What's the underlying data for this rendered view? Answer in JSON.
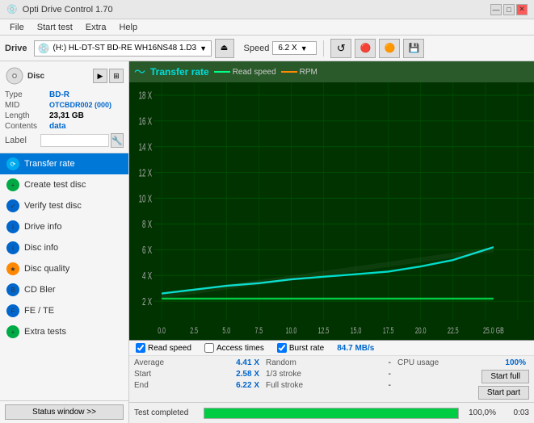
{
  "app": {
    "title": "Opti Drive Control 1.70",
    "title_icon": "💿"
  },
  "title_controls": {
    "minimize": "—",
    "maximize": "□",
    "close": "✕"
  },
  "menu": {
    "items": [
      "File",
      "Start test",
      "Extra",
      "Help"
    ]
  },
  "toolbar": {
    "drive_label": "Drive",
    "drive_value": "(H:) HL-DT-ST BD-RE  WH16NS48 1.D3",
    "speed_label": "Speed",
    "speed_value": "6.2 X"
  },
  "disc": {
    "type_label": "Type",
    "type_value": "BD-R",
    "mid_label": "MID",
    "mid_value": "OTCBDR002 (000)",
    "length_label": "Length",
    "length_value": "23,31 GB",
    "contents_label": "Contents",
    "contents_value": "data",
    "label_label": "Label",
    "label_value": ""
  },
  "nav": {
    "items": [
      {
        "id": "transfer-rate",
        "label": "Transfer rate",
        "active": true
      },
      {
        "id": "create-test-disc",
        "label": "Create test disc",
        "active": false
      },
      {
        "id": "verify-test-disc",
        "label": "Verify test disc",
        "active": false
      },
      {
        "id": "drive-info",
        "label": "Drive info",
        "active": false
      },
      {
        "id": "disc-info",
        "label": "Disc info",
        "active": false
      },
      {
        "id": "disc-quality",
        "label": "Disc quality",
        "active": false
      },
      {
        "id": "cd-bler",
        "label": "CD Bler",
        "active": false
      },
      {
        "id": "fe-te",
        "label": "FE / TE",
        "active": false
      },
      {
        "id": "extra-tests",
        "label": "Extra tests",
        "active": false
      }
    ]
  },
  "status_btn": "Status window >>",
  "chart": {
    "title": "Transfer rate",
    "legend": {
      "read_speed_label": "Read speed",
      "rpm_label": "RPM"
    },
    "y_labels": [
      "18 X",
      "16 X",
      "14 X",
      "12 X",
      "10 X",
      "8 X",
      "6 X",
      "4 X",
      "2 X"
    ],
    "x_labels": [
      "0.0",
      "2.5",
      "5.0",
      "7.5",
      "10.0",
      "12.5",
      "15.0",
      "17.5",
      "20.0",
      "22.5",
      "25.0 GB"
    ],
    "checkboxes": [
      {
        "id": "read-speed",
        "label": "Read speed",
        "checked": true
      },
      {
        "id": "access-times",
        "label": "Access times",
        "checked": false
      },
      {
        "id": "burst-rate",
        "label": "Burst rate",
        "checked": true
      }
    ],
    "burst_value": "84.7 MB/s"
  },
  "stats": {
    "average_label": "Average",
    "average_value": "4.41 X",
    "start_label": "Start",
    "start_value": "2.58 X",
    "end_label": "End",
    "end_value": "6.22 X",
    "random_label": "Random",
    "random_value": "-",
    "one_third_label": "1/3 stroke",
    "one_third_value": "-",
    "full_stroke_label": "Full stroke",
    "full_stroke_value": "-",
    "cpu_label": "CPU usage",
    "cpu_value": "100%"
  },
  "buttons": {
    "start_full": "Start full",
    "start_part": "Start part"
  },
  "progress": {
    "label": "Test completed",
    "percent": "100,0%",
    "time": "0:03"
  }
}
